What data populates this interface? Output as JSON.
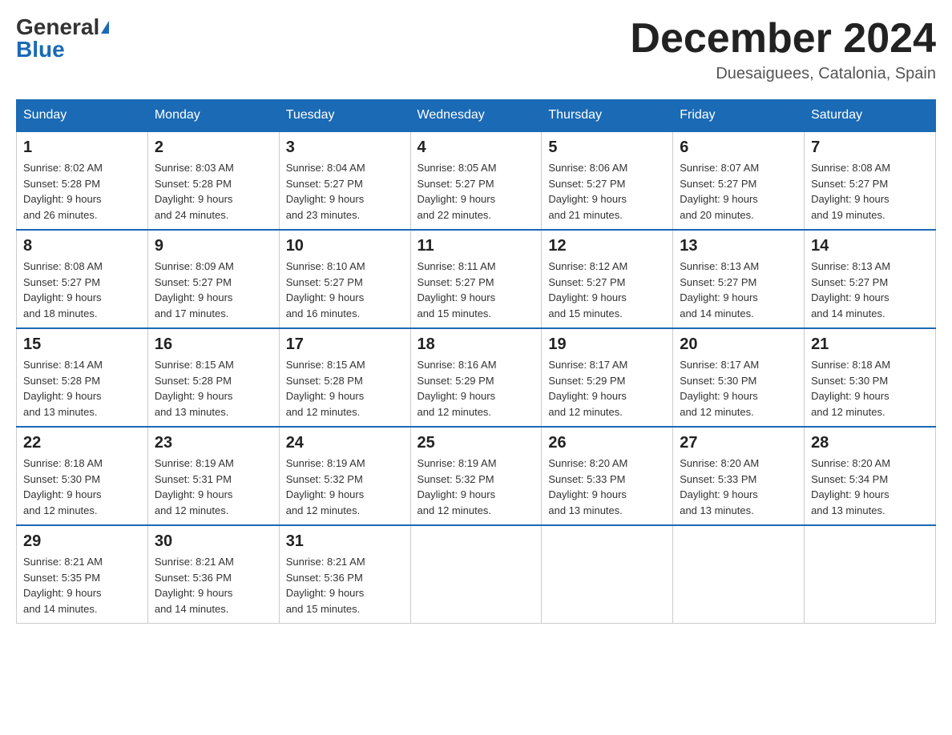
{
  "logo": {
    "general": "General",
    "blue": "Blue"
  },
  "title": "December 2024",
  "location": "Duesaiguees, Catalonia, Spain",
  "days_of_week": [
    "Sunday",
    "Monday",
    "Tuesday",
    "Wednesday",
    "Thursday",
    "Friday",
    "Saturday"
  ],
  "weeks": [
    [
      {
        "day": "1",
        "sunrise": "8:02 AM",
        "sunset": "5:28 PM",
        "daylight": "9 hours and 26 minutes."
      },
      {
        "day": "2",
        "sunrise": "8:03 AM",
        "sunset": "5:28 PM",
        "daylight": "9 hours and 24 minutes."
      },
      {
        "day": "3",
        "sunrise": "8:04 AM",
        "sunset": "5:27 PM",
        "daylight": "9 hours and 23 minutes."
      },
      {
        "day": "4",
        "sunrise": "8:05 AM",
        "sunset": "5:27 PM",
        "daylight": "9 hours and 22 minutes."
      },
      {
        "day": "5",
        "sunrise": "8:06 AM",
        "sunset": "5:27 PM",
        "daylight": "9 hours and 21 minutes."
      },
      {
        "day": "6",
        "sunrise": "8:07 AM",
        "sunset": "5:27 PM",
        "daylight": "9 hours and 20 minutes."
      },
      {
        "day": "7",
        "sunrise": "8:08 AM",
        "sunset": "5:27 PM",
        "daylight": "9 hours and 19 minutes."
      }
    ],
    [
      {
        "day": "8",
        "sunrise": "8:08 AM",
        "sunset": "5:27 PM",
        "daylight": "9 hours and 18 minutes."
      },
      {
        "day": "9",
        "sunrise": "8:09 AM",
        "sunset": "5:27 PM",
        "daylight": "9 hours and 17 minutes."
      },
      {
        "day": "10",
        "sunrise": "8:10 AM",
        "sunset": "5:27 PM",
        "daylight": "9 hours and 16 minutes."
      },
      {
        "day": "11",
        "sunrise": "8:11 AM",
        "sunset": "5:27 PM",
        "daylight": "9 hours and 15 minutes."
      },
      {
        "day": "12",
        "sunrise": "8:12 AM",
        "sunset": "5:27 PM",
        "daylight": "9 hours and 15 minutes."
      },
      {
        "day": "13",
        "sunrise": "8:13 AM",
        "sunset": "5:27 PM",
        "daylight": "9 hours and 14 minutes."
      },
      {
        "day": "14",
        "sunrise": "8:13 AM",
        "sunset": "5:27 PM",
        "daylight": "9 hours and 14 minutes."
      }
    ],
    [
      {
        "day": "15",
        "sunrise": "8:14 AM",
        "sunset": "5:28 PM",
        "daylight": "9 hours and 13 minutes."
      },
      {
        "day": "16",
        "sunrise": "8:15 AM",
        "sunset": "5:28 PM",
        "daylight": "9 hours and 13 minutes."
      },
      {
        "day": "17",
        "sunrise": "8:15 AM",
        "sunset": "5:28 PM",
        "daylight": "9 hours and 12 minutes."
      },
      {
        "day": "18",
        "sunrise": "8:16 AM",
        "sunset": "5:29 PM",
        "daylight": "9 hours and 12 minutes."
      },
      {
        "day": "19",
        "sunrise": "8:17 AM",
        "sunset": "5:29 PM",
        "daylight": "9 hours and 12 minutes."
      },
      {
        "day": "20",
        "sunrise": "8:17 AM",
        "sunset": "5:30 PM",
        "daylight": "9 hours and 12 minutes."
      },
      {
        "day": "21",
        "sunrise": "8:18 AM",
        "sunset": "5:30 PM",
        "daylight": "9 hours and 12 minutes."
      }
    ],
    [
      {
        "day": "22",
        "sunrise": "8:18 AM",
        "sunset": "5:30 PM",
        "daylight": "9 hours and 12 minutes."
      },
      {
        "day": "23",
        "sunrise": "8:19 AM",
        "sunset": "5:31 PM",
        "daylight": "9 hours and 12 minutes."
      },
      {
        "day": "24",
        "sunrise": "8:19 AM",
        "sunset": "5:32 PM",
        "daylight": "9 hours and 12 minutes."
      },
      {
        "day": "25",
        "sunrise": "8:19 AM",
        "sunset": "5:32 PM",
        "daylight": "9 hours and 12 minutes."
      },
      {
        "day": "26",
        "sunrise": "8:20 AM",
        "sunset": "5:33 PM",
        "daylight": "9 hours and 13 minutes."
      },
      {
        "day": "27",
        "sunrise": "8:20 AM",
        "sunset": "5:33 PM",
        "daylight": "9 hours and 13 minutes."
      },
      {
        "day": "28",
        "sunrise": "8:20 AM",
        "sunset": "5:34 PM",
        "daylight": "9 hours and 13 minutes."
      }
    ],
    [
      {
        "day": "29",
        "sunrise": "8:21 AM",
        "sunset": "5:35 PM",
        "daylight": "9 hours and 14 minutes."
      },
      {
        "day": "30",
        "sunrise": "8:21 AM",
        "sunset": "5:36 PM",
        "daylight": "9 hours and 14 minutes."
      },
      {
        "day": "31",
        "sunrise": "8:21 AM",
        "sunset": "5:36 PM",
        "daylight": "9 hours and 15 minutes."
      },
      null,
      null,
      null,
      null
    ]
  ]
}
